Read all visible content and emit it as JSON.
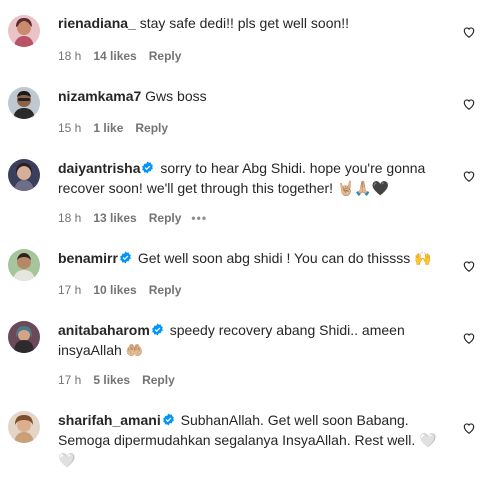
{
  "comments": [
    {
      "username": "rienadiana_",
      "verified": false,
      "text": "stay safe dedi!! pls get well soon!!",
      "time": "18 h",
      "likes": "14 likes",
      "reply": "Reply"
    },
    {
      "username": "nizamkama7",
      "verified": false,
      "text": "Gws boss",
      "time": "15 h",
      "likes": "1 like",
      "reply": "Reply"
    },
    {
      "username": "daiyantrisha",
      "verified": true,
      "text": "sorry to hear Abg Shidi. hope you're gonna recover soon! we'll get through this together! 🤘🏼🙏🏼🖤",
      "time": "18 h",
      "likes": "13 likes",
      "reply": "Reply",
      "more": "•••"
    },
    {
      "username": "benamirr",
      "verified": true,
      "text": "Get well soon abg shidi ! You can do thissss 🙌",
      "time": "17 h",
      "likes": "10 likes",
      "reply": "Reply"
    },
    {
      "username": "anitabaharom",
      "verified": true,
      "text": "speedy recovery abang Shidi.. ameen insyaAllah 🤲🏼",
      "time": "17 h",
      "likes": "5 likes",
      "reply": "Reply"
    },
    {
      "username": "sharifah_amani",
      "verified": true,
      "text": "SubhanAllah. Get well soon Babang. Semoga dipermudahkan segalanya InsyaAllah. Rest well. 🤍🤍"
    }
  ],
  "colors": {
    "text": "#262626",
    "meta": "#737373",
    "verified": "#0095f6"
  },
  "icons": {
    "like": "heart-outline-icon",
    "verified": "verified-badge-icon"
  }
}
